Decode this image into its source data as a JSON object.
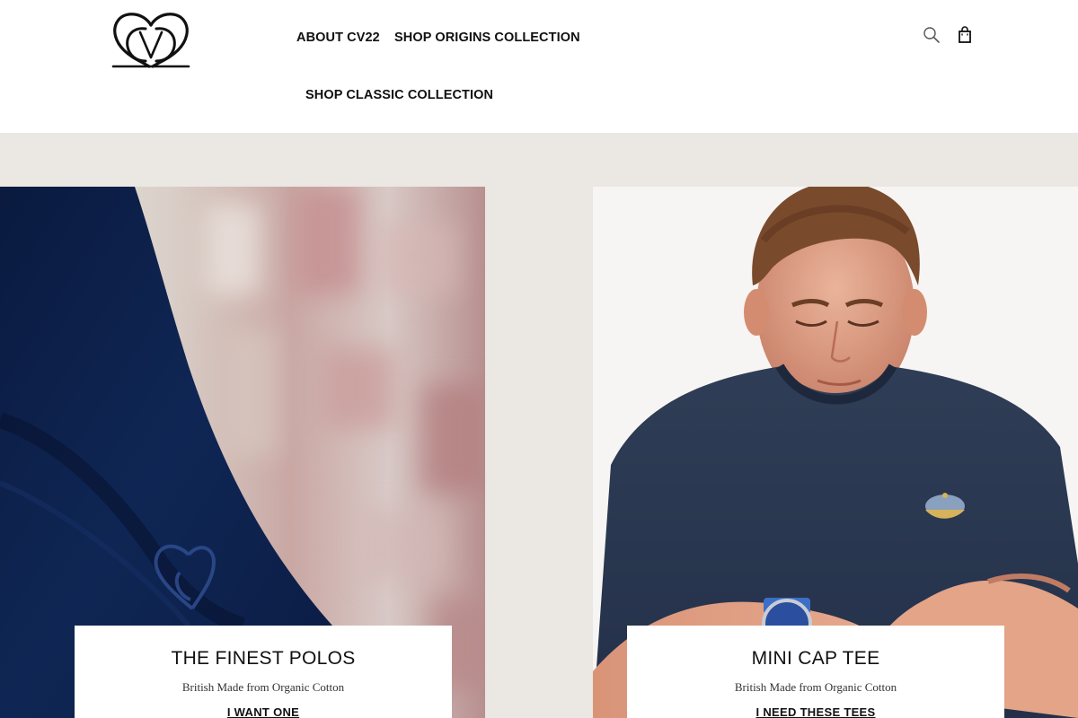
{
  "header": {
    "brand": "CV22",
    "nav": [
      {
        "label": "ABOUT CV22"
      },
      {
        "label": "SHOP ORIGINS COLLECTION"
      },
      {
        "label": "SHOP CLASSIC COLLECTION"
      }
    ],
    "icons": {
      "search": "search-icon",
      "cart": "shopping-bag-icon"
    }
  },
  "tiles": [
    {
      "title": "THE FINEST POLOS",
      "subtitle": "British Made from Organic Cotton",
      "cta": "I WANT ONE",
      "image": "navy-polo-closeup-with-embroidered-logo"
    },
    {
      "title": "MINI CAP TEE",
      "subtitle": "British Made from Organic Cotton",
      "cta": "I NEED THESE TEES",
      "image": "man-in-navy-tee-with-cap-badge"
    }
  ],
  "colors": {
    "background": "#ebe7e2",
    "header": "#ffffff",
    "navy": "#0c1f48",
    "text": "#111111"
  }
}
